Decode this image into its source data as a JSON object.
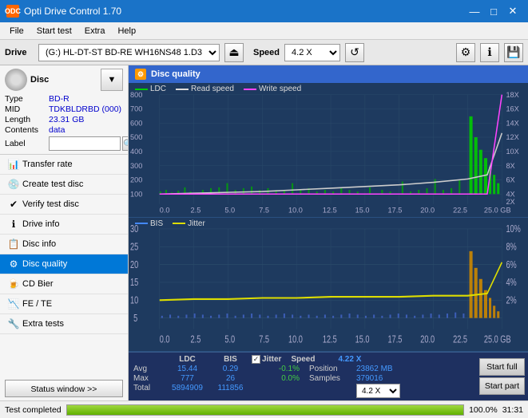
{
  "titleBar": {
    "title": "Opti Drive Control 1.70",
    "icon": "ODC",
    "minimizeBtn": "—",
    "maximizeBtn": "□",
    "closeBtn": "✕"
  },
  "menuBar": {
    "items": [
      "File",
      "Start test",
      "Extra",
      "Help"
    ]
  },
  "driveToolbar": {
    "driveLabel": "Drive",
    "driveValue": "(G:)  HL-DT-ST BD-RE  WH16NS48 1.D3",
    "speedLabel": "Speed",
    "speedValue": "4.2 X",
    "icons": [
      "eject",
      "back",
      "forward",
      "save"
    ]
  },
  "disc": {
    "type_label": "Type",
    "type_value": "BD-R",
    "mid_label": "MID",
    "mid_value": "TDKBLDRBD (000)",
    "length_label": "Length",
    "length_value": "23.31 GB",
    "contents_label": "Contents",
    "contents_value": "data",
    "label_label": "Label",
    "label_value": ""
  },
  "navItems": [
    {
      "id": "transfer-rate",
      "label": "Transfer rate",
      "icon": "📊"
    },
    {
      "id": "create-test-disc",
      "label": "Create test disc",
      "icon": "💿"
    },
    {
      "id": "verify-test-disc",
      "label": "Verify test disc",
      "icon": "✔"
    },
    {
      "id": "drive-info",
      "label": "Drive info",
      "icon": "ℹ"
    },
    {
      "id": "disc-info",
      "label": "Disc info",
      "icon": "📋"
    },
    {
      "id": "disc-quality",
      "label": "Disc quality",
      "icon": "⚙",
      "active": true
    },
    {
      "id": "cd-bier",
      "label": "CD Bier",
      "icon": "🍺"
    },
    {
      "id": "fe-te",
      "label": "FE / TE",
      "icon": "📉"
    },
    {
      "id": "extra-tests",
      "label": "Extra tests",
      "icon": "🔧"
    }
  ],
  "statusBtn": "Status window >>",
  "discQuality": {
    "title": "Disc quality",
    "legend": {
      "ldc": "LDC",
      "readSpeed": "Read speed",
      "writeSpeed": "Write speed",
      "bis": "BIS",
      "jitter": "Jitter"
    },
    "chart1": {
      "yMax": 800,
      "yAxisLabels": [
        "800",
        "700",
        "600",
        "500",
        "400",
        "300",
        "200",
        "100"
      ],
      "yAxisRight": [
        "18X",
        "16X",
        "14X",
        "12X",
        "10X",
        "8X",
        "6X",
        "4X",
        "2X"
      ],
      "xLabels": [
        "0.0",
        "2.5",
        "5.0",
        "7.5",
        "10.0",
        "12.5",
        "15.0",
        "17.5",
        "20.0",
        "22.5",
        "25.0 GB"
      ]
    },
    "chart2": {
      "yMax": 30,
      "yAxisLabels": [
        "30",
        "25",
        "20",
        "15",
        "10",
        "5"
      ],
      "yAxisRight": [
        "10%",
        "8%",
        "6%",
        "4%",
        "2%"
      ],
      "xLabels": [
        "0.0",
        "2.5",
        "5.0",
        "7.5",
        "10.0",
        "12.5",
        "15.0",
        "17.5",
        "20.0",
        "22.5",
        "25.0 GB"
      ]
    },
    "stats": {
      "headers": [
        "",
        "LDC",
        "BIS",
        "",
        "Jitter",
        "Speed",
        ""
      ],
      "avg_label": "Avg",
      "avg_ldc": "15.44",
      "avg_bis": "0.29",
      "avg_jitter": "-0.1%",
      "max_label": "Max",
      "max_ldc": "777",
      "max_bis": "26",
      "max_jitter": "0.0%",
      "total_label": "Total",
      "total_ldc": "5894909",
      "total_bis": "111856",
      "speed_value": "4.22 X",
      "speed_label": "Speed",
      "position_value": "23862 MB",
      "position_label": "Position",
      "samples_value": "379016",
      "samples_label": "Samples",
      "speed_select": "4.2 X"
    },
    "buttons": {
      "startFull": "Start full",
      "startPart": "Start part"
    }
  },
  "bottomStatus": {
    "text": "Test completed",
    "progress": 100,
    "progressText": "100.0%",
    "time": "31:31"
  }
}
